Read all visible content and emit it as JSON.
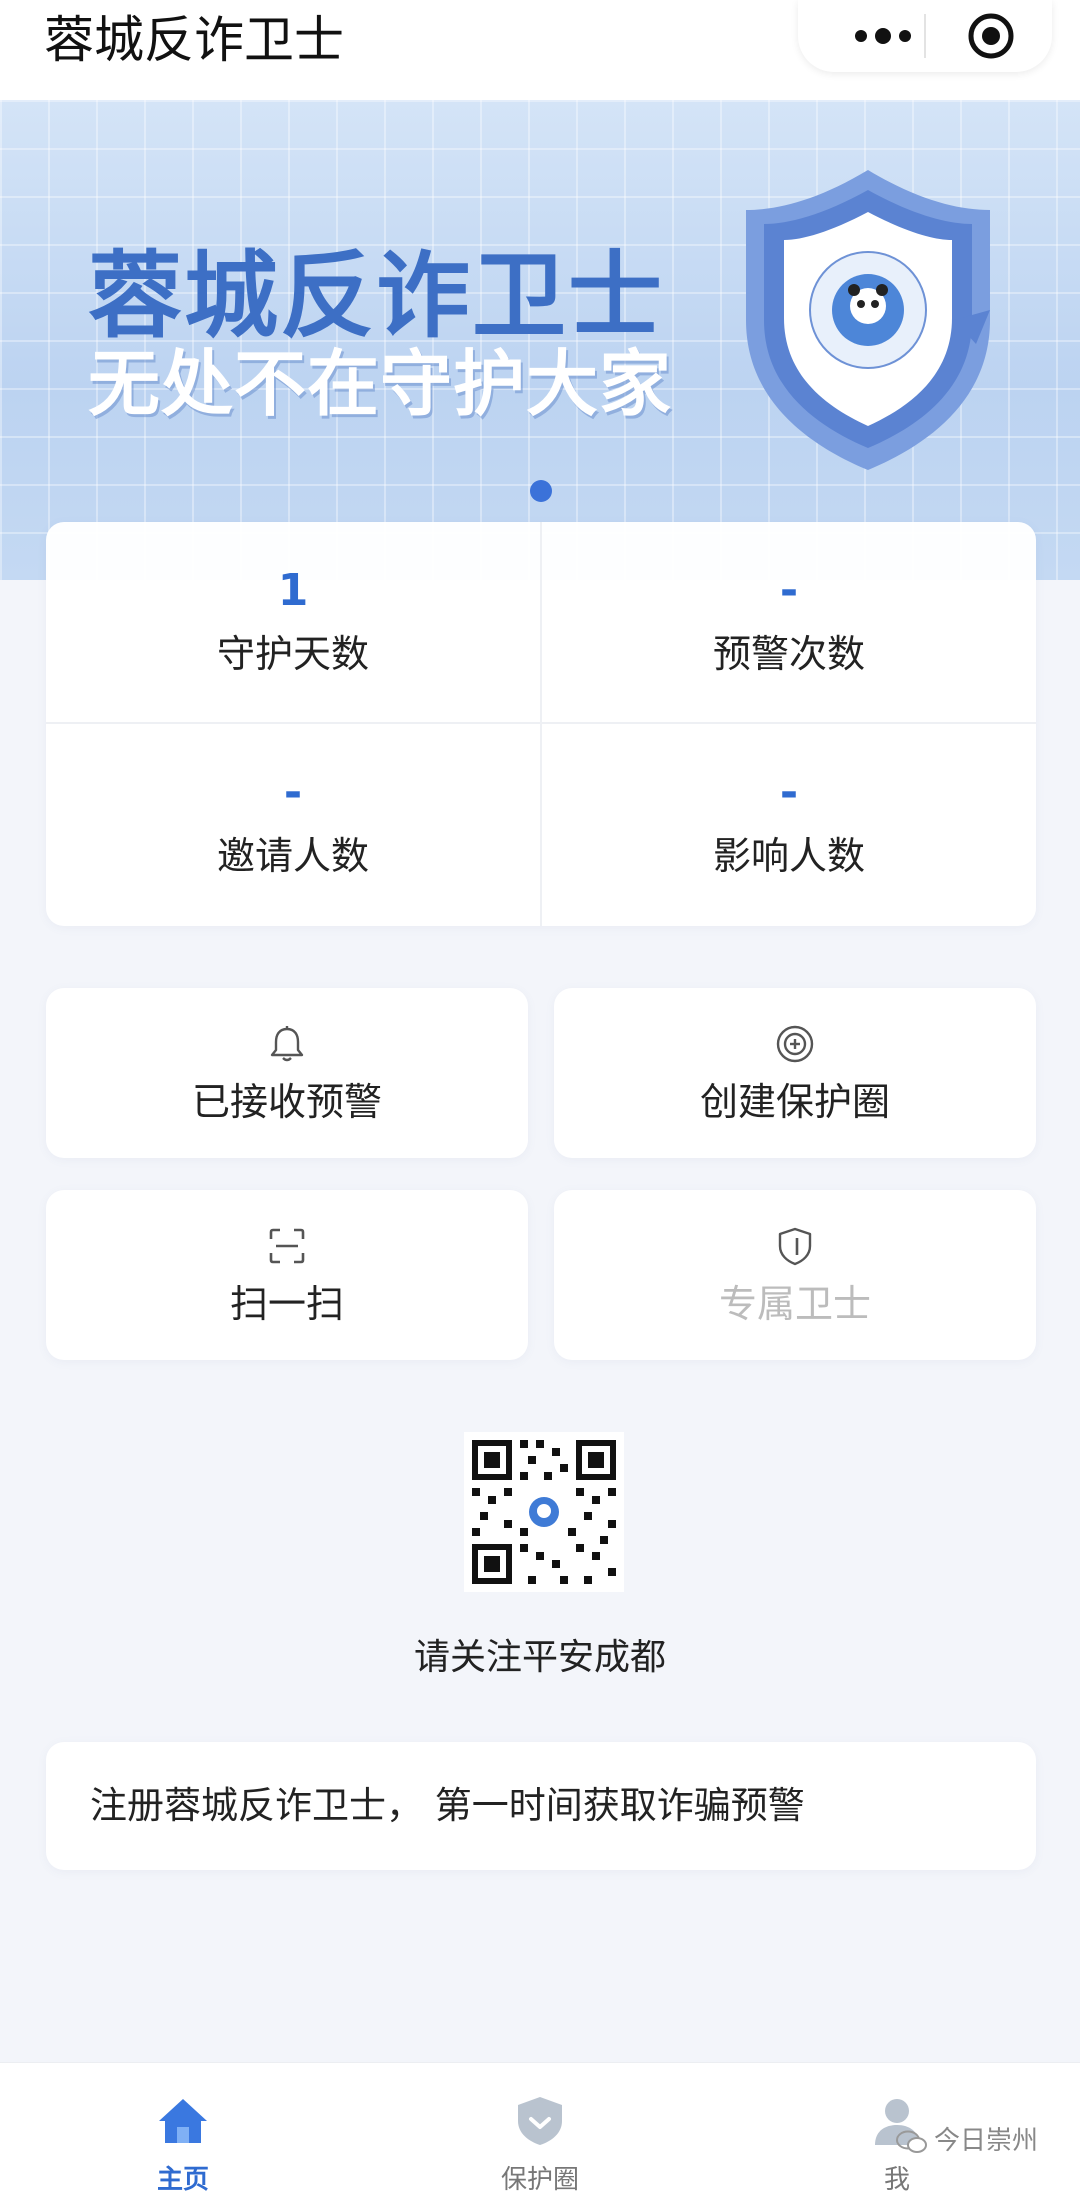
{
  "header": {
    "title": "蓉城反诈卫士",
    "more_icon": "more-dots-icon",
    "close_icon": "target-close-icon"
  },
  "banner": {
    "headline": "蓉城反诈卫士",
    "subline": "无处不在守护大家",
    "shield_icon": "shield-badge-icon",
    "page_indicator": {
      "count": 1,
      "active": 0
    }
  },
  "stats": [
    {
      "value": "1",
      "label": "守护天数"
    },
    {
      "value": "-",
      "label": "预警次数"
    },
    {
      "value": "-",
      "label": "邀请人数"
    },
    {
      "value": "-",
      "label": "影响人数"
    }
  ],
  "actions": [
    {
      "label": "已接收预警",
      "icon": "bell-icon",
      "enabled": true
    },
    {
      "label": "创建保护圈",
      "icon": "circle-plus-icon",
      "enabled": true
    },
    {
      "label": "扫一扫",
      "icon": "scan-icon",
      "enabled": true
    },
    {
      "label": "专属卫士",
      "icon": "shield-icon",
      "enabled": false
    }
  ],
  "qr": {
    "caption": "请关注平安成都"
  },
  "notice": {
    "text": "注册蓉城反诈卫士， 第一时间获取诈骗预警"
  },
  "tabs": [
    {
      "label": "主页",
      "icon": "home-icon",
      "active": true
    },
    {
      "label": "保护圈",
      "icon": "shield-tab-icon",
      "active": false
    },
    {
      "label": "我",
      "icon": "user-icon",
      "active": false
    }
  ],
  "watermark": {
    "text": "今日崇州",
    "icon": "wechat-icon"
  },
  "colors": {
    "accent": "#2f6bd0",
    "banner_bg": "#c6daf3",
    "page_bg": "#f3f5fa",
    "disabled": "#bcbcbc"
  }
}
